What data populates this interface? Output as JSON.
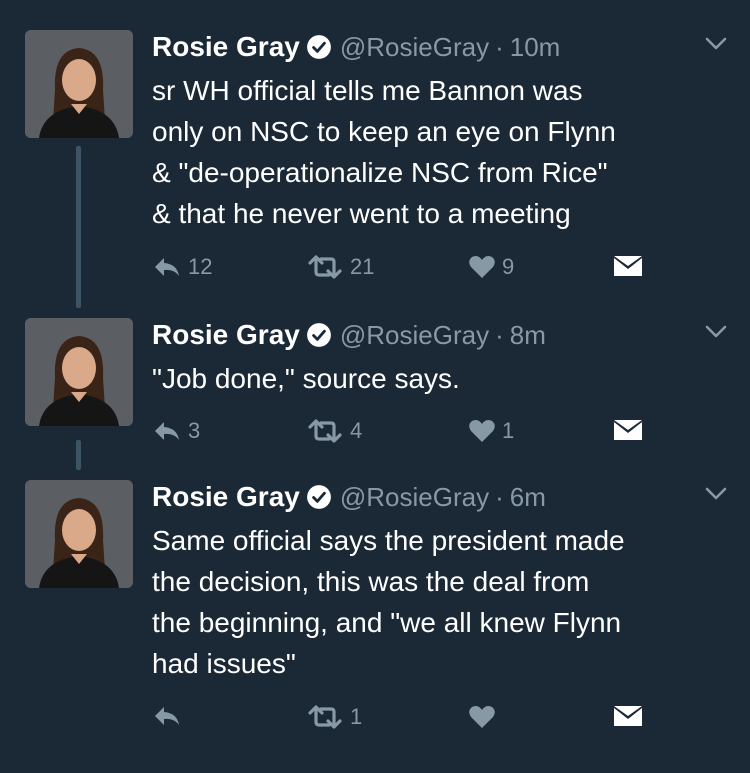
{
  "tweets": [
    {
      "name": "Rosie Gray",
      "handle": "@RosieGray",
      "separator": "·",
      "time": "10m",
      "text": "sr WH official tells me Bannon was\nonly on NSC to keep an eye on Flynn\n& \"de-operationalize NSC from Rice\"\n& that he never went to a meeting",
      "replies": "12",
      "retweets": "21",
      "likes": "9"
    },
    {
      "name": "Rosie Gray",
      "handle": "@RosieGray",
      "separator": "·",
      "time": "8m",
      "text": "\"Job done,\" source says.",
      "replies": "3",
      "retweets": "4",
      "likes": "1"
    },
    {
      "name": "Rosie Gray",
      "handle": "@RosieGray",
      "separator": "·",
      "time": "6m",
      "text": "Same official says the president made\nthe decision, this was the deal from\nthe beginning, and \"we all knew Flynn\nhad issues\"",
      "replies": "",
      "retweets": "1",
      "likes": ""
    }
  ],
  "icons": {
    "reply": "reply-icon",
    "retweet": "retweet-icon",
    "like": "heart-icon",
    "dm": "envelope-icon",
    "menu": "chevron-down-icon",
    "verified": "verified-badge-icon"
  },
  "colors": {
    "background": "#1b2836",
    "muted": "#8899a6",
    "thread_line": "#3d5466",
    "text": "#ffffff"
  }
}
